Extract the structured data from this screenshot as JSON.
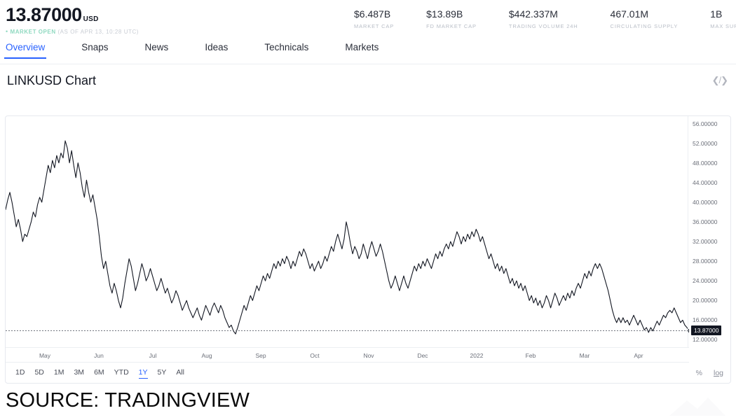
{
  "header": {
    "price": "13.87000",
    "currency": "USD",
    "status_dot": "bullet-dot",
    "status": "MARKET OPEN",
    "as_of": "(AS OF APR 13, 10:28 UTC)",
    "status_color": "#8fd9c0",
    "stats": [
      {
        "value": "$6.487B",
        "label": "MARKET CAP"
      },
      {
        "value": "$13.89B",
        "label": "FD MARKET CAP"
      },
      {
        "value": "$442.337M",
        "label": "TRADING VOLUME 24H"
      },
      {
        "value": "467.01M",
        "label": "CIRCULATING SUPPLY"
      },
      {
        "value": "1B",
        "label": "MAX SUPPLY"
      }
    ]
  },
  "tabs": [
    {
      "label": "Overview",
      "active": true
    },
    {
      "label": "Snaps",
      "active": false
    },
    {
      "label": "News",
      "active": false
    },
    {
      "label": "Ideas",
      "active": false
    },
    {
      "label": "Technicals",
      "active": false
    },
    {
      "label": "Markets",
      "active": false
    }
  ],
  "chart_header": {
    "title": "LINKUSD Chart",
    "embed_icon": "code-embed-icon"
  },
  "toolbar": {
    "ranges": [
      {
        "label": "1D",
        "active": false
      },
      {
        "label": "5D",
        "active": false
      },
      {
        "label": "1M",
        "active": false
      },
      {
        "label": "3M",
        "active": false
      },
      {
        "label": "6M",
        "active": false
      },
      {
        "label": "YTD",
        "active": false
      },
      {
        "label": "1Y",
        "active": true
      },
      {
        "label": "5Y",
        "active": false
      },
      {
        "label": "All",
        "active": false
      }
    ],
    "percent_label": "%",
    "log_label": "log"
  },
  "footer": {
    "source": "SOURCE: TRADINGVIEW"
  },
  "accent_color": "#2962ff",
  "line_color": "#131722",
  "chart_data": {
    "type": "line",
    "title": "LINKUSD Chart",
    "xlabel": "",
    "ylabel": "",
    "ylim": [
      10.5,
      57.5
    ],
    "grid": false,
    "legend": false,
    "current_price": 13.87,
    "current_price_label": "13.87000",
    "y_ticks": [
      "56.00000",
      "52.00000",
      "48.00000",
      "44.00000",
      "40.00000",
      "36.00000",
      "32.00000",
      "28.00000",
      "24.00000",
      "20.00000",
      "16.00000",
      "12.00000"
    ],
    "y_tick_values": [
      56,
      52,
      48,
      44,
      40,
      36,
      32,
      28,
      24,
      20,
      16,
      12
    ],
    "x_ticks": [
      "May",
      "Jun",
      "Jul",
      "Aug",
      "Sep",
      "Oct",
      "Nov",
      "Dec",
      "2022",
      "Feb",
      "Mar",
      "Apr"
    ],
    "series": [
      {
        "name": "LINKUSD",
        "color": "#131722",
        "values": [
          38.5,
          40.5,
          42.0,
          40.0,
          37.5,
          35.0,
          36.5,
          34.5,
          32.0,
          33.5,
          33.0,
          34.5,
          36.0,
          38.0,
          37.0,
          39.5,
          41.0,
          40.0,
          42.5,
          45.0,
          47.5,
          46.0,
          48.5,
          47.0,
          49.5,
          48.0,
          50.0,
          49.0,
          52.5,
          51.0,
          48.0,
          50.5,
          47.5,
          45.0,
          48.0,
          46.0,
          43.0,
          41.0,
          44.5,
          42.0,
          40.0,
          41.5,
          39.0,
          36.5,
          33.0,
          29.0,
          26.5,
          28.0,
          25.5,
          23.0,
          21.5,
          23.5,
          22.0,
          20.0,
          18.5,
          20.5,
          23.5,
          26.0,
          28.5,
          27.0,
          24.5,
          22.0,
          23.5,
          25.5,
          27.5,
          26.0,
          24.0,
          25.0,
          26.5,
          25.0,
          23.5,
          22.0,
          23.0,
          24.5,
          23.0,
          21.5,
          22.5,
          21.0,
          19.5,
          20.5,
          22.0,
          21.0,
          19.5,
          18.0,
          19.0,
          20.0,
          18.5,
          17.5,
          16.5,
          17.5,
          18.5,
          17.0,
          16.0,
          17.5,
          19.0,
          18.0,
          17.0,
          18.5,
          19.5,
          18.5,
          17.5,
          19.0,
          18.0,
          16.5,
          15.5,
          14.5,
          15.0,
          13.8,
          13.2,
          14.5,
          16.0,
          17.5,
          19.0,
          18.0,
          19.5,
          21.0,
          20.0,
          21.5,
          23.0,
          22.0,
          23.5,
          25.0,
          24.0,
          25.5,
          24.5,
          26.0,
          27.5,
          26.5,
          28.0,
          27.0,
          28.5,
          27.5,
          29.0,
          28.0,
          26.5,
          28.0,
          27.0,
          28.5,
          30.0,
          29.0,
          30.5,
          29.5,
          28.0,
          26.5,
          27.5,
          26.0,
          27.0,
          28.0,
          26.5,
          27.5,
          29.0,
          28.0,
          29.5,
          31.0,
          30.0,
          32.0,
          33.5,
          32.0,
          30.5,
          32.5,
          36.0,
          34.0,
          31.5,
          29.5,
          31.0,
          30.0,
          28.5,
          29.5,
          31.5,
          30.0,
          28.5,
          30.5,
          32.0,
          30.5,
          29.0,
          30.0,
          31.5,
          30.0,
          28.0,
          26.0,
          24.0,
          22.5,
          23.5,
          25.0,
          23.5,
          22.0,
          23.5,
          25.0,
          23.5,
          22.5,
          24.0,
          25.5,
          27.0,
          26.0,
          27.5,
          26.5,
          28.0,
          27.0,
          28.5,
          27.5,
          26.5,
          28.0,
          29.5,
          28.5,
          30.0,
          29.0,
          30.5,
          31.5,
          30.5,
          32.0,
          31.0,
          32.5,
          34.0,
          33.0,
          31.5,
          33.0,
          32.0,
          33.5,
          32.5,
          34.0,
          33.0,
          34.5,
          33.5,
          32.0,
          33.0,
          31.5,
          30.0,
          28.5,
          29.5,
          28.0,
          26.5,
          27.5,
          26.0,
          27.0,
          25.5,
          26.5,
          25.0,
          23.5,
          24.5,
          23.0,
          24.0,
          22.5,
          23.5,
          22.0,
          23.0,
          21.5,
          20.0,
          21.0,
          19.5,
          20.5,
          19.0,
          20.0,
          18.5,
          19.5,
          21.0,
          20.0,
          18.5,
          20.0,
          21.5,
          20.5,
          19.0,
          20.0,
          21.0,
          20.0,
          21.5,
          20.5,
          22.0,
          21.0,
          22.5,
          23.5,
          22.5,
          24.0,
          25.5,
          24.5,
          26.0,
          25.0,
          26.5,
          27.5,
          26.5,
          27.5,
          26.5,
          25.0,
          23.5,
          22.0,
          20.0,
          18.0,
          16.5,
          15.5,
          16.5,
          15.5,
          16.5,
          15.5,
          16.0,
          15.0,
          16.0,
          17.0,
          16.0,
          15.0,
          16.0,
          15.0,
          14.0,
          14.5,
          13.5,
          14.5,
          13.8,
          14.8,
          15.8,
          15.0,
          16.0,
          17.0,
          16.5,
          17.5,
          18.0,
          17.5,
          18.5,
          17.5,
          16.5,
          15.5,
          16.0,
          15.0,
          14.5,
          13.87
        ]
      }
    ]
  }
}
